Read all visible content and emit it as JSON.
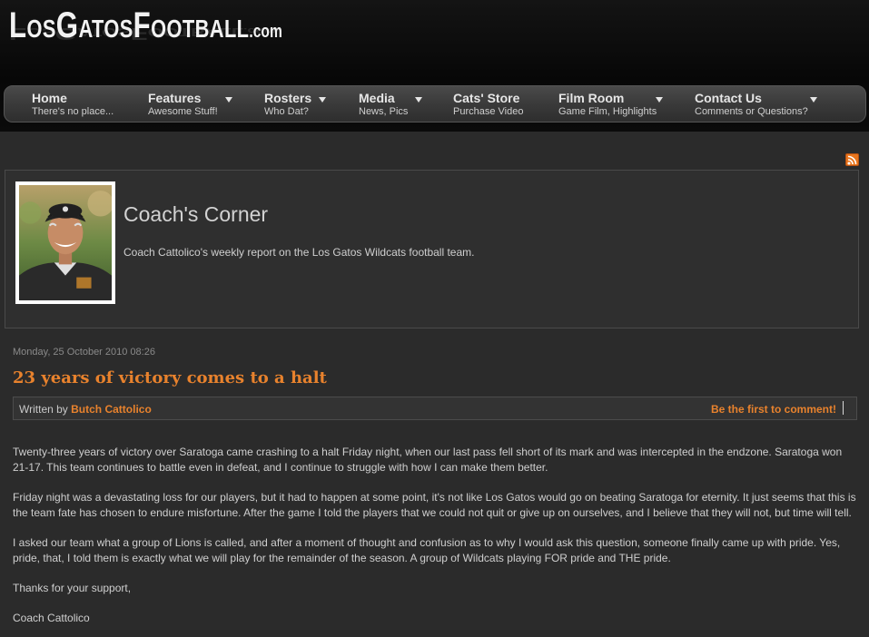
{
  "site": {
    "logo_main": "LosGatosFootball",
    "logo_parts": {
      "L": "L",
      "os": "OS",
      "G": "G",
      "atos": "ATOS",
      "F": "F",
      "ootball": "OOTBALL",
      "dotcom": ".com"
    }
  },
  "nav": {
    "items": [
      {
        "title": "Home",
        "sub": "There's no place...",
        "has_dropdown": false
      },
      {
        "title": "Features",
        "sub": "Awesome Stuff!",
        "has_dropdown": true
      },
      {
        "title": "Rosters",
        "sub": "Who Dat?",
        "has_dropdown": true
      },
      {
        "title": "Media",
        "sub": "News, Pics",
        "has_dropdown": true
      },
      {
        "title": "Cats' Store",
        "sub": "Purchase Video",
        "has_dropdown": false
      },
      {
        "title": "Film Room",
        "sub": "Game Film, Highlights",
        "has_dropdown": true
      },
      {
        "title": "Contact Us",
        "sub": "Comments or Questions?",
        "has_dropdown": true
      }
    ]
  },
  "rss": {
    "icon": "rss-feed-icon",
    "color": "#e9761e"
  },
  "coach": {
    "title": "Coach's Corner",
    "description": "Coach Cattolico's weekly report on the Los Gatos Wildcats football team."
  },
  "article": {
    "date": "Monday, 25 October 2010 08:26",
    "title": "23 years of victory comes to a halt",
    "written_by_label": "Written by",
    "author": "Butch Cattolico",
    "comment_link": "Be the first to comment!",
    "paragraphs": [
      "Twenty-three years of victory over Saratoga came crashing to a halt Friday night, when our last pass fell short of its mark and was intercepted in the endzone. Saratoga won 21-17. This team continues to battle even in defeat, and I continue to struggle with how I can make them better.",
      "Friday night was a devastating loss for our players, but it had to happen at some point, it's not like Los Gatos would go on beating Saratoga for eternity. It just seems that this is the team fate has chosen to endure misfortune. After the game I told the players that we could not quit or give up on ourselves, and I believe that they will not, but time will tell.",
      "I asked our team what a group of Lions is called, and after a moment of thought and confusion as to why I would ask this question, someone finally came up with pride. Yes, pride, that, I told them is exactly what we will play for the remainder of the season. A group of Wildcats playing FOR pride and THE pride.",
      "Thanks for your support,",
      "Coach Cattolico"
    ]
  },
  "colors": {
    "accent": "#e8822d",
    "background": "#2b2b2b",
    "header": "#0a0a0a"
  }
}
